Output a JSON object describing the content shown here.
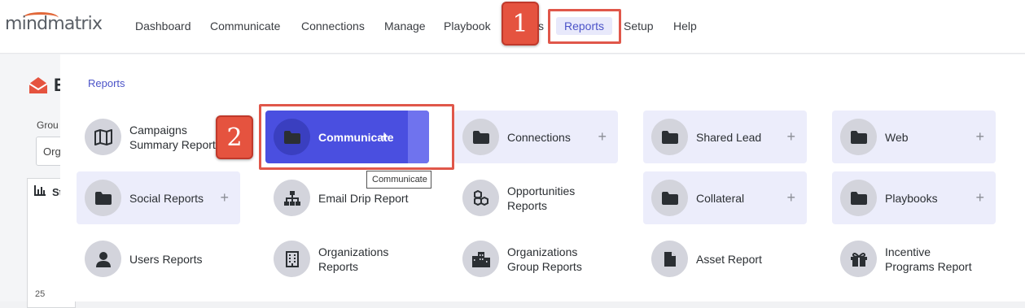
{
  "logo": {
    "text": "mindmatrix"
  },
  "nav": {
    "items": [
      "Dashboard",
      "Communicate",
      "Connections",
      "Manage",
      "Playbook",
      "s",
      "Reports",
      "Setup",
      "Help"
    ],
    "active": "Reports"
  },
  "callouts": {
    "one": "1",
    "two": "2"
  },
  "background_page": {
    "title_initial": "E",
    "group_label": "Grou",
    "group_value": "Org",
    "stats_label": "St",
    "axis_tick": "25"
  },
  "menu": {
    "breadcrumb": "Reports",
    "tooltip": "Communicate",
    "tiles": [
      {
        "label": "Campaigns Summary Report",
        "line1": "Campaigns",
        "line2": "Summary Report",
        "icon": "map-icon",
        "expandable": false,
        "highlighted": false
      },
      {
        "label": "Communicate",
        "icon": "folder-icon",
        "expandable": true,
        "highlighted": true
      },
      {
        "label": "Connections",
        "icon": "folder-icon",
        "expandable": true
      },
      {
        "label": "Shared Lead",
        "icon": "folder-icon",
        "expandable": true
      },
      {
        "label": "Web",
        "icon": "folder-icon",
        "expandable": true
      },
      {
        "label": "Social Reports",
        "icon": "folder-icon",
        "expandable": true
      },
      {
        "label": "Email Drip Report",
        "icon": "sitemap-icon",
        "expandable": false
      },
      {
        "label": "Opportunities Reports",
        "line1": "Opportunities",
        "line2": "Reports",
        "icon": "cubes-icon",
        "expandable": false
      },
      {
        "label": "Collateral",
        "icon": "folder-icon",
        "expandable": true
      },
      {
        "label": "Playbooks",
        "icon": "folder-icon",
        "expandable": true
      },
      {
        "label": "Users Reports",
        "icon": "user-icon",
        "expandable": false
      },
      {
        "label": "Organizations Reports",
        "line1": "Organizations",
        "line2": "Reports",
        "icon": "building-icon",
        "expandable": false
      },
      {
        "label": "Organizations Group Reports",
        "line1": "Organizations",
        "line2": "Group Reports",
        "icon": "city-icon",
        "expandable": false
      },
      {
        "label": "Asset Report",
        "icon": "file-icon",
        "expandable": false
      },
      {
        "label": "Incentive Programs Report",
        "line1": "Incentive",
        "line2": "Programs Report",
        "icon": "gift-icon",
        "expandable": false
      }
    ],
    "plus_symbol": "+"
  },
  "colors": {
    "accent": "#4a4fe0",
    "callout": "#e5533f",
    "brand": "#e1683a"
  }
}
